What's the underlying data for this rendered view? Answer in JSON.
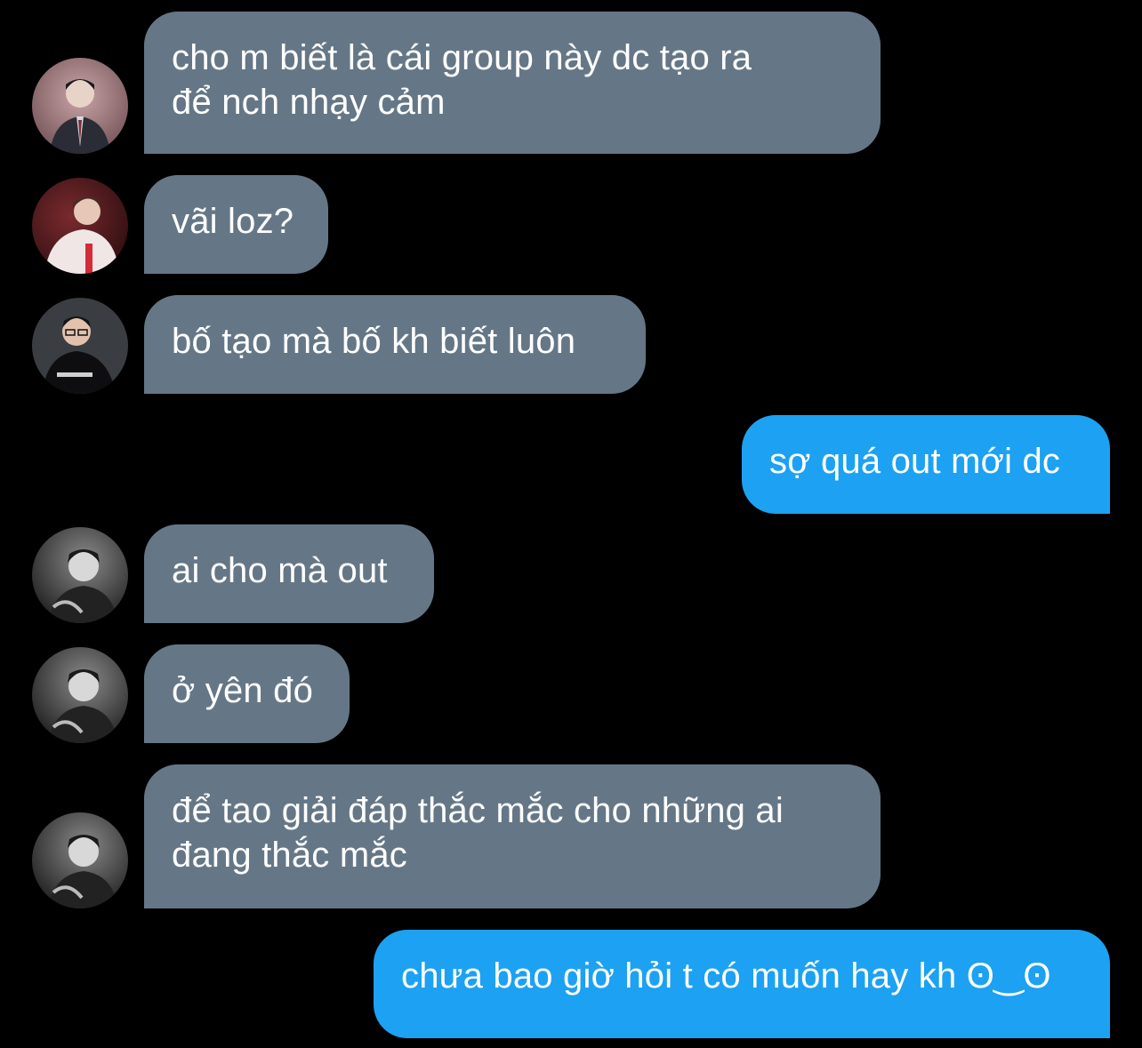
{
  "colors": {
    "background": "#000000",
    "incoming_bubble": "#657786",
    "outgoing_bubble": "#1da1f2",
    "text": "#ffffff"
  },
  "messages": [
    {
      "direction": "incoming",
      "text": "cho m biết là cái group này dc tạo ra\nđể nch nhạy cảm",
      "avatar": "user-avatar-icon"
    },
    {
      "direction": "incoming",
      "text": "vãi loz?",
      "avatar": "user-avatar-icon"
    },
    {
      "direction": "incoming",
      "text": "bố tạo mà bố kh biết luôn",
      "avatar": "user-avatar-icon"
    },
    {
      "direction": "outgoing",
      "text": "sợ quá out mới dc"
    },
    {
      "direction": "incoming",
      "text": "ai cho mà out",
      "avatar": "user-avatar-icon"
    },
    {
      "direction": "incoming",
      "text": "ở yên đó",
      "avatar": "user-avatar-icon"
    },
    {
      "direction": "incoming",
      "text": "để tao giải đáp thắc mắc cho những ai\nđang thắc mắc",
      "avatar": "user-avatar-icon"
    },
    {
      "direction": "outgoing",
      "text": "chưa bao giờ hỏi t có muốn hay kh ʘ‿ʘ"
    }
  ]
}
